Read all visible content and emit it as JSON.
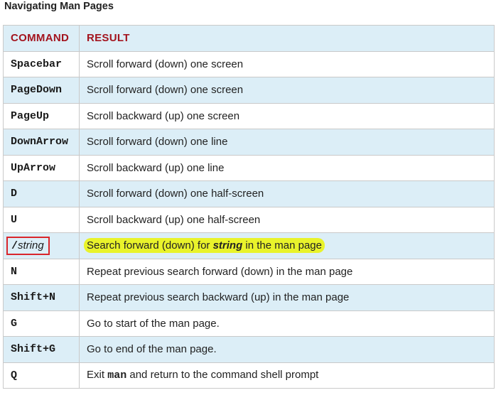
{
  "caption": "Navigating Man Pages",
  "headers": {
    "command": "COMMAND",
    "result": "RESULT"
  },
  "rows": [
    {
      "command": "Spacebar",
      "result": "Scroll forward (down) one screen"
    },
    {
      "command": "PageDown",
      "result": "Scroll forward (down) one screen"
    },
    {
      "command": "PageUp",
      "result": "Scroll backward (up) one screen"
    },
    {
      "command": "DownArrow",
      "result": "Scroll forward (down) one line"
    },
    {
      "command": "UpArrow",
      "result": "Scroll backward (up) one line"
    },
    {
      "command": "D",
      "result": "Scroll forward (down) one half-screen"
    },
    {
      "command": "U",
      "result": "Scroll backward (up) one half-screen"
    },
    {
      "command_prefix": "/",
      "command_arg": "string",
      "result_before": "Search forward (down) for ",
      "result_emph": "string",
      "result_after": " in the man page"
    },
    {
      "command": "N",
      "result": "Repeat previous search forward (down) in the man page"
    },
    {
      "command": "Shift+N",
      "result": "Repeat previous search backward (up) in the man page"
    },
    {
      "command": "G",
      "result": "Go to start of the man page."
    },
    {
      "command": "Shift+G",
      "result": "Go to end of the man page."
    },
    {
      "command": "Q",
      "result_before": "Exit ",
      "result_code": "man",
      "result_after": " and return to the command shell prompt"
    }
  ],
  "colors": {
    "header_text": "#a3141e",
    "row_shade": "#dceef7",
    "highlight": "#e9f32b",
    "callout_border": "#d9252b"
  }
}
